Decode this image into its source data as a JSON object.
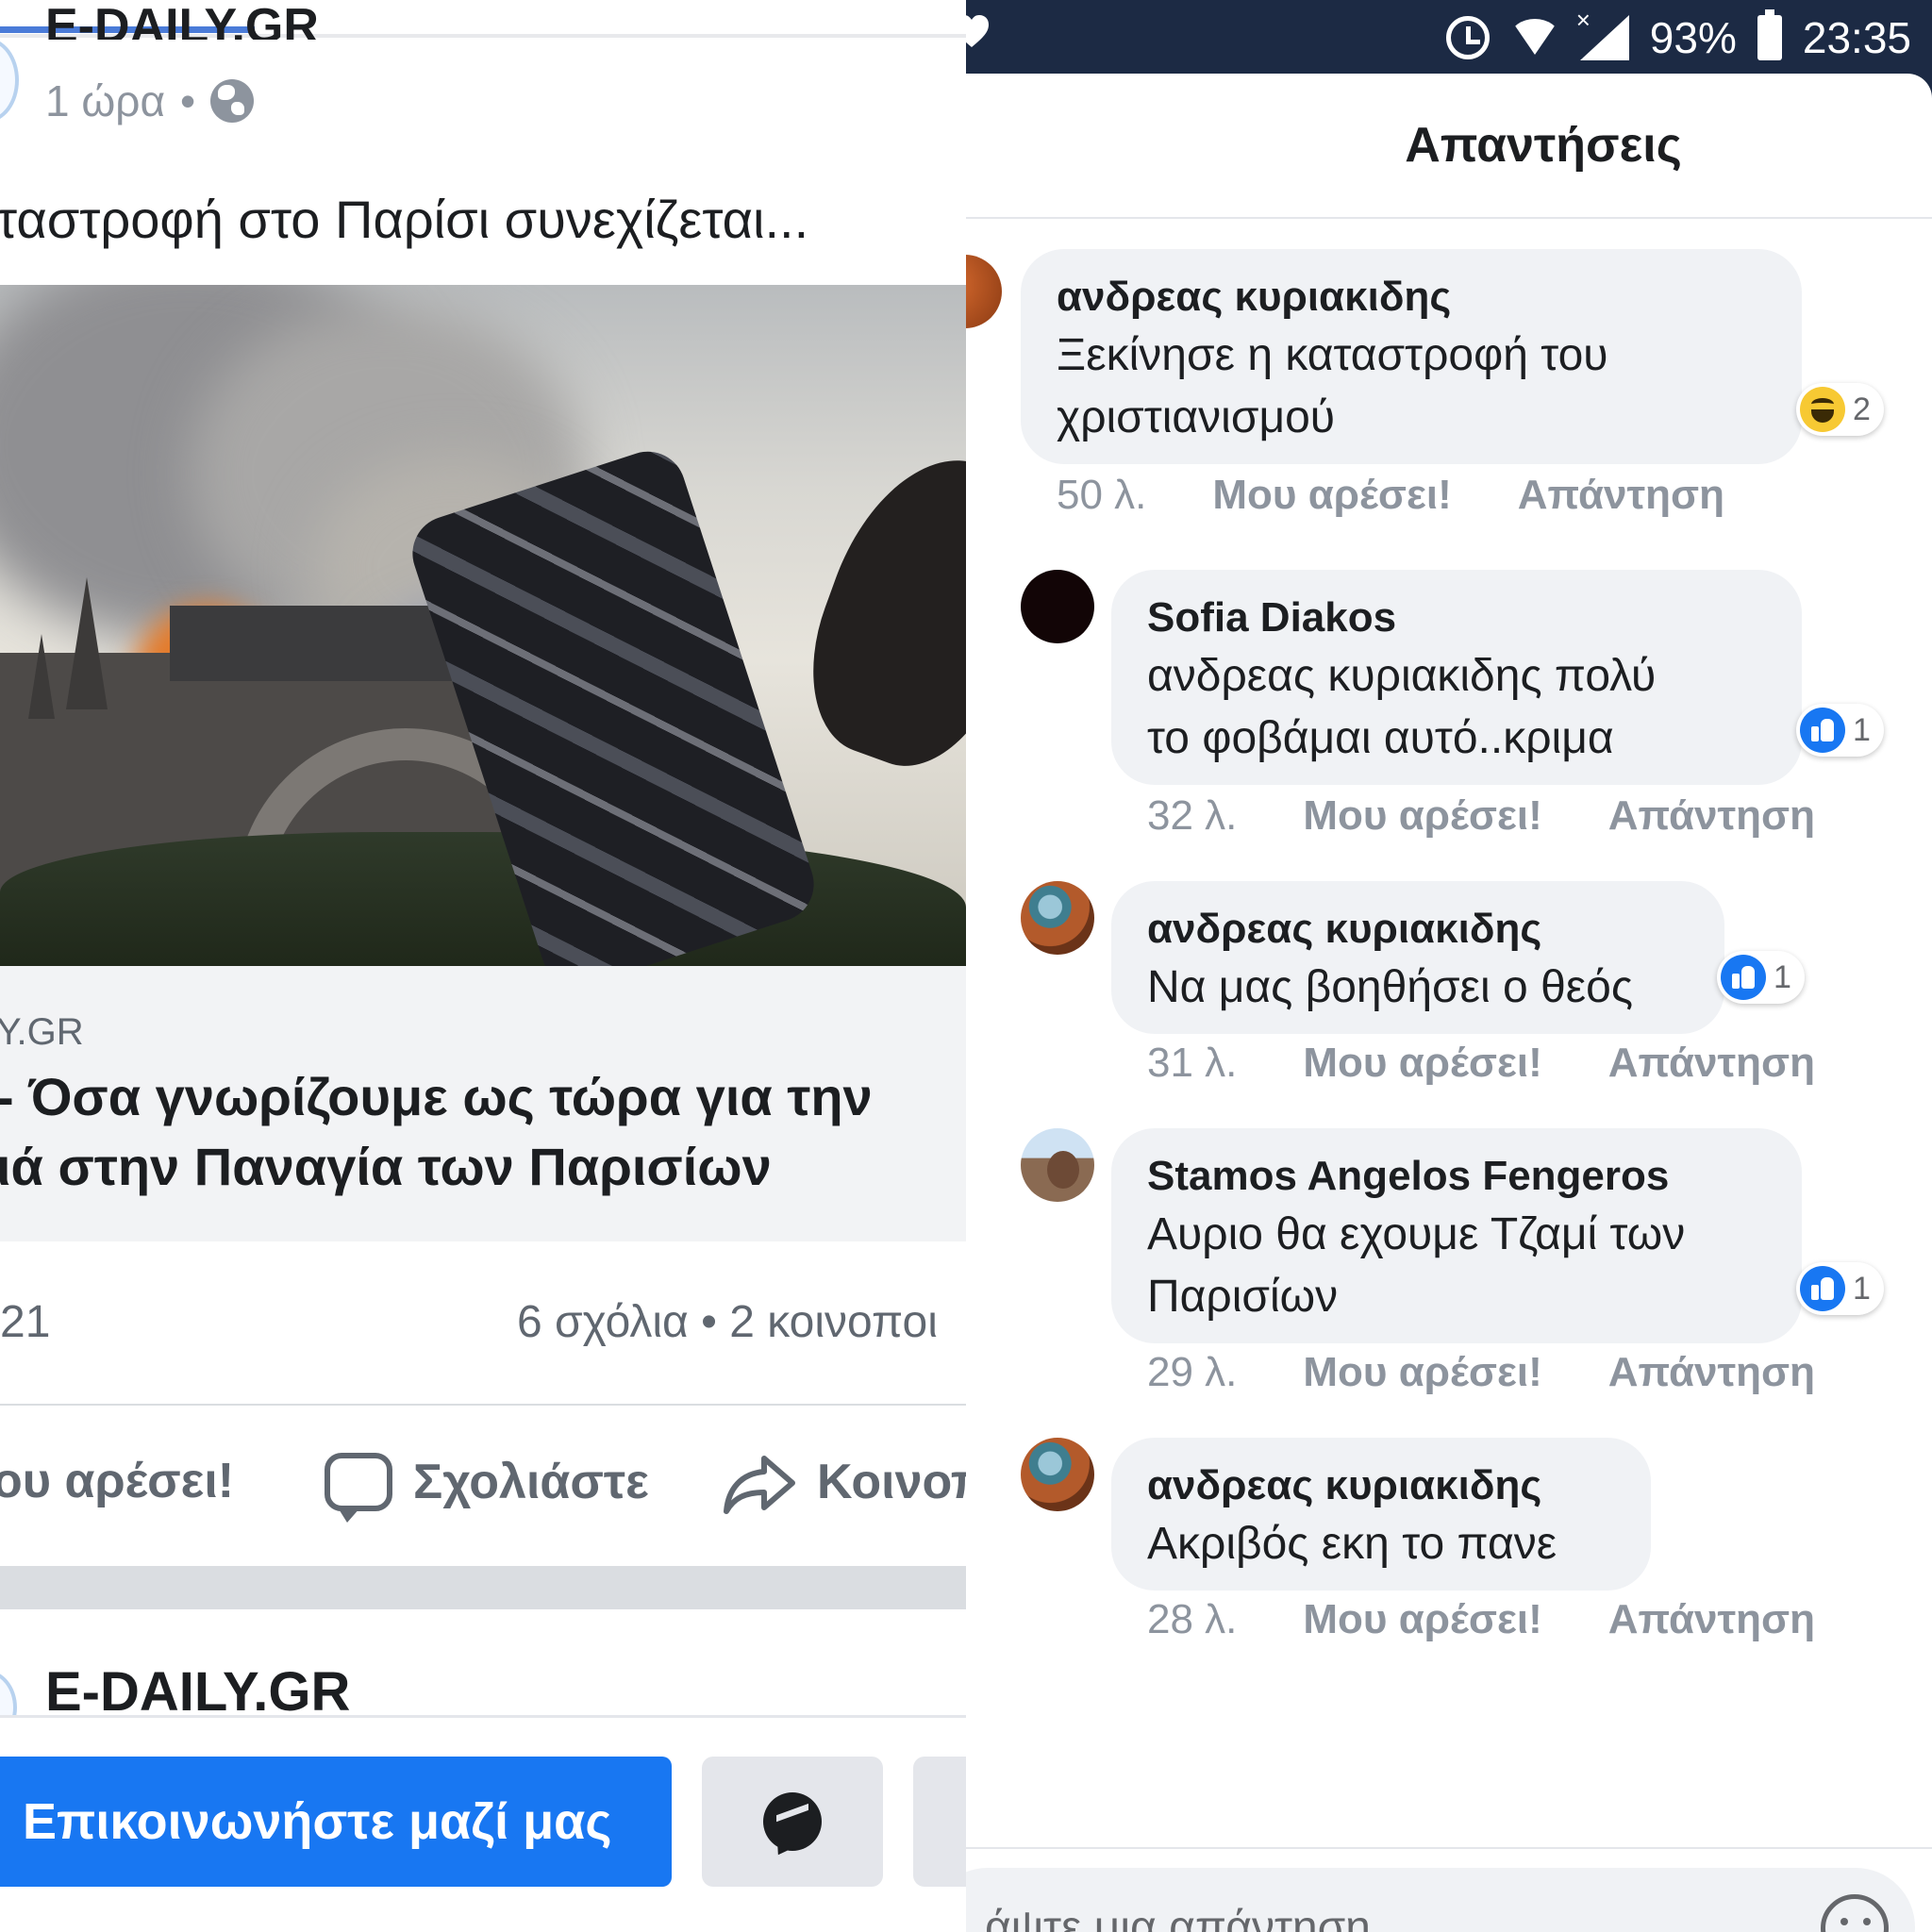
{
  "left": {
    "page_name": "E-DAILY.GR",
    "post_time": "1 ώρα",
    "time_separator": "•",
    "globe_icon": "globe-icon",
    "post_text": "ταστροφή στο Παρίσι συνεχίζεται...",
    "link_domain": "Y.GR",
    "link_title_line1": "- Όσα γνωρίζουμε ως τώρα για την",
    "link_title_line2": "ιά στην Παναγία των Παρισίων",
    "likes_count": "21",
    "comments_shares": "6 σχόλια • 2 κοινοποι",
    "actions": {
      "like_label": "ου αρέσει!",
      "comment_label": "Σχολιάστε",
      "share_label": "Κοινοπ"
    },
    "next_page_name": "E-DAILY.GR",
    "contact_button": "Επικοινωνήστε μαζί μας",
    "accent_color": "#1877f2"
  },
  "status_bar": {
    "battery": "93%",
    "time": "23:35",
    "icons": [
      "heart-icon",
      "alarm-icon",
      "wifi-icon",
      "signal-icon",
      "battery-icon"
    ]
  },
  "replies": {
    "title": "Απαντήσεις",
    "like_action": "Μου αρέσει!",
    "reply_action": "Απάντηση",
    "comments": [
      {
        "author": "ανδρεας κυριακιδης",
        "lines": [
          "Ξεκίνησε η καταστροφή του",
          "χριστιανισμού"
        ],
        "age": "50 λ.",
        "reaction": "haha",
        "reaction_count": "2"
      },
      {
        "author": "Sofia Diakos",
        "lines": [
          "ανδρεας κυριακιδης πολύ",
          "το φοβάμαι αυτό..κριμα"
        ],
        "age": "32 λ.",
        "reaction": "like",
        "reaction_count": "1"
      },
      {
        "author": "ανδρεας κυριακιδης",
        "lines": [
          "Να μας βοηθήσει ο θεός"
        ],
        "age": "31 λ.",
        "reaction": "like",
        "reaction_count": "1"
      },
      {
        "author": "Stamos Angelos Fengeros",
        "lines": [
          "Αυριο θα εχουμε Τζαμί των",
          "Παρισίων"
        ],
        "age": "29 λ.",
        "reaction": "like",
        "reaction_count": "1"
      },
      {
        "author": "ανδρεας κυριακιδης",
        "lines": [
          "Ακριβός εκη το πανε"
        ],
        "age": "28 λ.",
        "reaction": "",
        "reaction_count": ""
      }
    ],
    "composer_placeholder": "άψτε μια απάντηση..."
  }
}
